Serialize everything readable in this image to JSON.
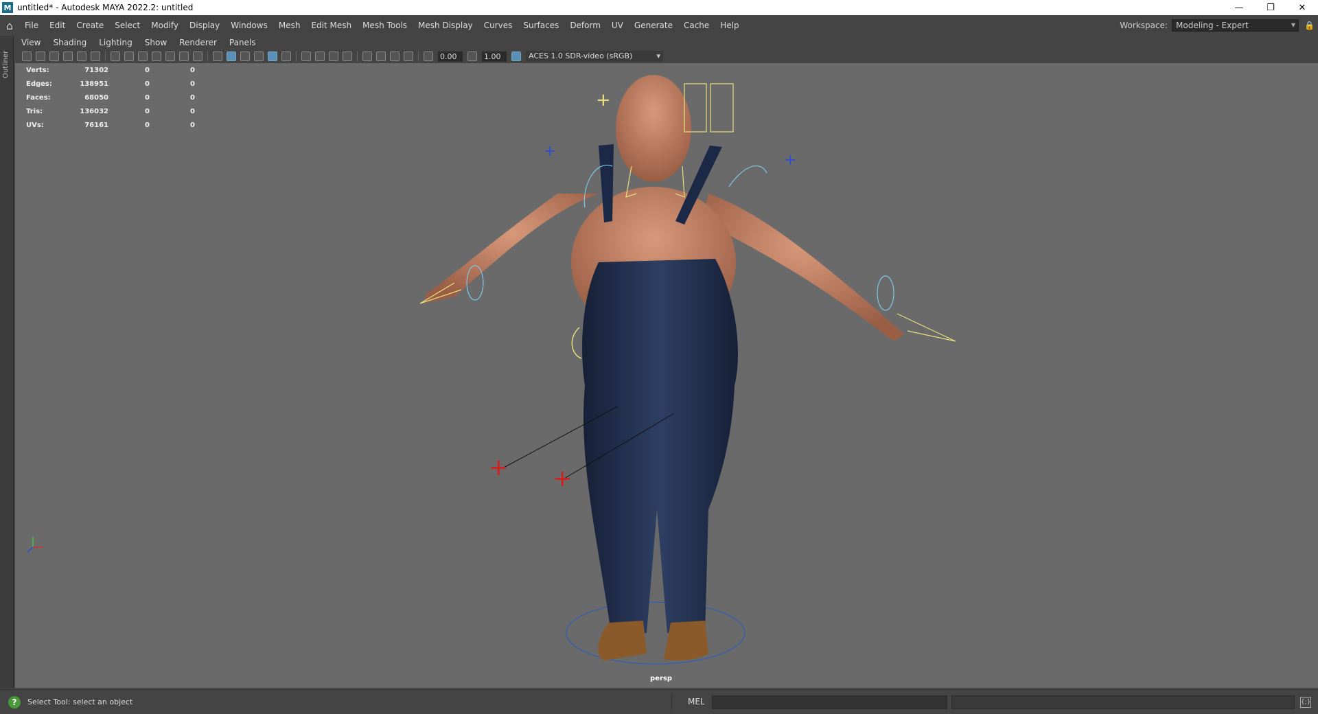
{
  "window": {
    "title": "untitled* - Autodesk MAYA 2022.2: untitled",
    "app_icon": "maya-icon",
    "controls": {
      "minimize": "—",
      "restore": "❐",
      "close": "✕"
    }
  },
  "menubar": {
    "items": [
      "File",
      "Edit",
      "Create",
      "Select",
      "Modify",
      "Display",
      "Windows",
      "Mesh",
      "Edit Mesh",
      "Mesh Tools",
      "Mesh Display",
      "Curves",
      "Surfaces",
      "Deform",
      "UV",
      "Generate",
      "Cache",
      "Help"
    ]
  },
  "workspace": {
    "label": "Workspace:",
    "value": "Modeling - Expert"
  },
  "outliner_tab": "Outliner",
  "panel_menu": [
    "View",
    "Shading",
    "Lighting",
    "Show",
    "Renderer",
    "Panels"
  ],
  "toolbar": {
    "exposure": "0.00",
    "gamma": "1.00",
    "color_space": "ACES 1.0 SDR-video (sRGB)"
  },
  "hud": {
    "rows": [
      {
        "label": "Verts:",
        "v1": "71302",
        "v2": "0",
        "v3": "0"
      },
      {
        "label": "Edges:",
        "v1": "138951",
        "v2": "0",
        "v3": "0"
      },
      {
        "label": "Faces:",
        "v1": "68050",
        "v2": "0",
        "v3": "0"
      },
      {
        "label": "Tris:",
        "v1": "136032",
        "v2": "0",
        "v3": "0"
      },
      {
        "label": "UVs:",
        "v1": "76161",
        "v2": "0",
        "v3": "0"
      }
    ]
  },
  "viewport": {
    "camera": "persp",
    "background": "#6a6a6a"
  },
  "statusbar": {
    "help_text": "Select Tool: select an object",
    "mel_label": "MEL"
  },
  "colors": {
    "ui_bg": "#444444",
    "accent": "#5a8fb8",
    "skin": "#c08063",
    "denim": "#1e2a45"
  }
}
